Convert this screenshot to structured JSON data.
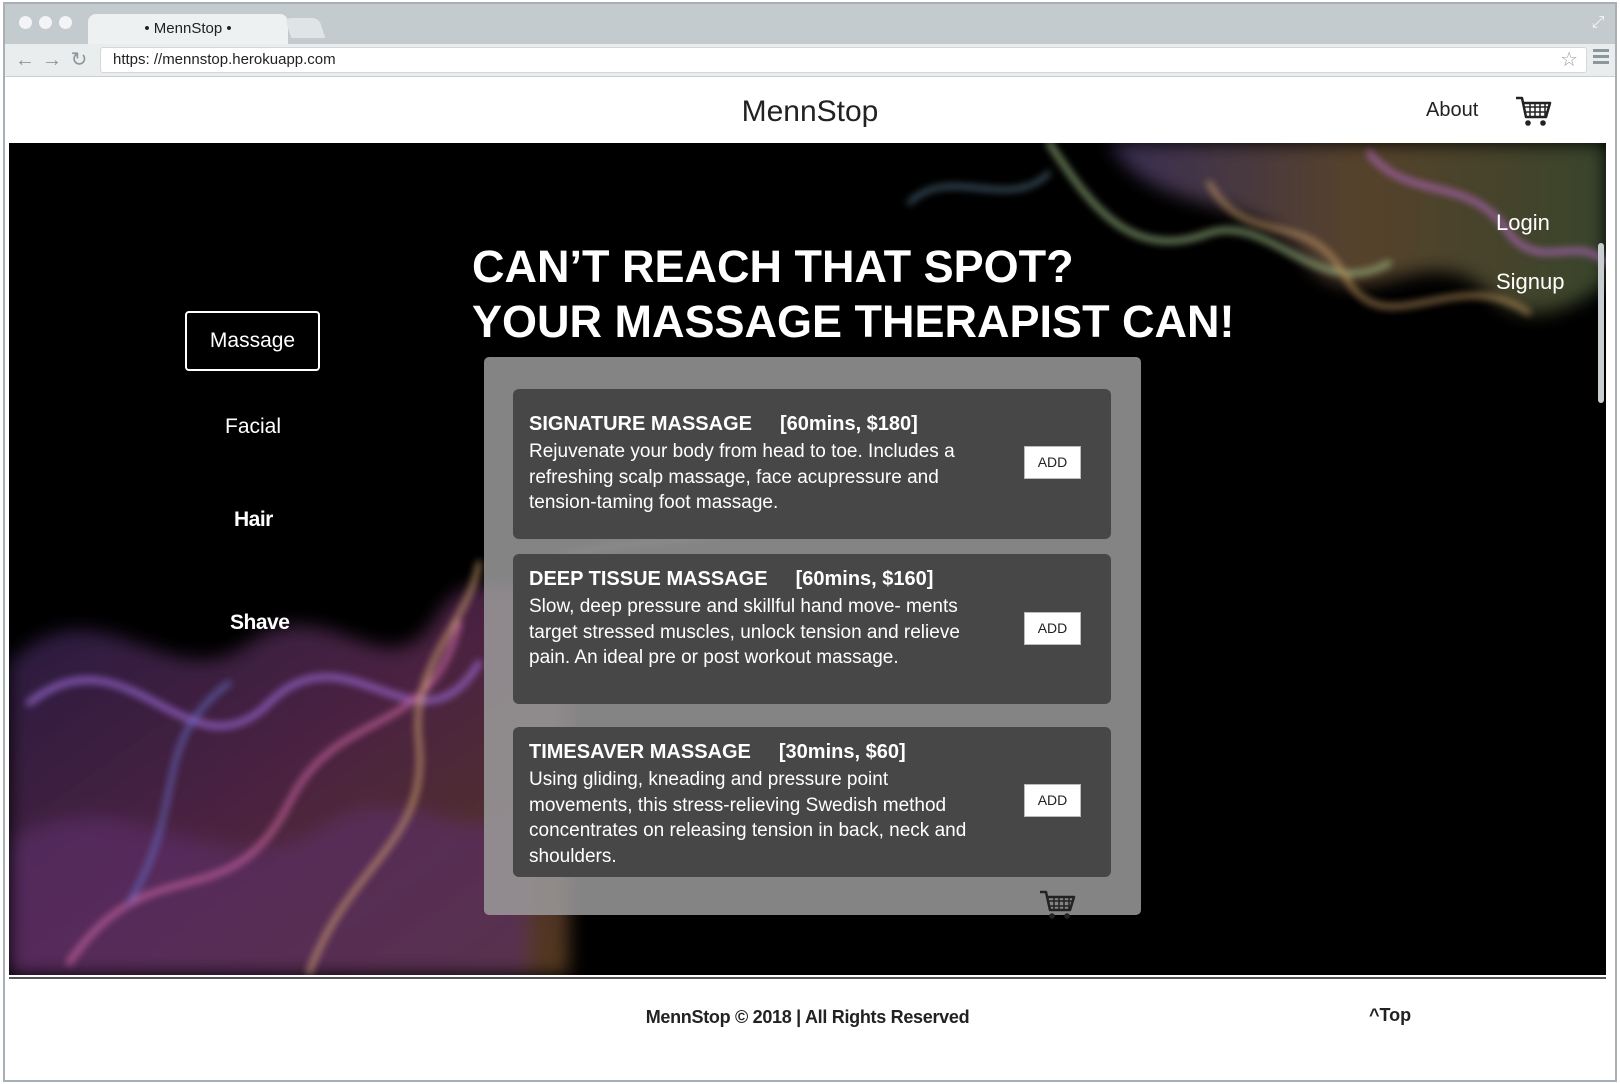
{
  "browser": {
    "tab_title": "• MennStop •",
    "url": "https: //mennstop.herokuapp.com"
  },
  "header": {
    "brand": "MennStop",
    "about": "About"
  },
  "auth": {
    "login": "Login",
    "signup": "Signup"
  },
  "headline": {
    "line1": "CAN’T REACH THAT SPOT?",
    "line2": "YOUR MASSAGE THERAPIST CAN!"
  },
  "sidenav": {
    "items": [
      {
        "label": "Massage",
        "active": true
      },
      {
        "label": "Facial"
      },
      {
        "label": "Hair"
      },
      {
        "label": "Shave"
      }
    ]
  },
  "services": [
    {
      "name": "SIGNATURE MASSAGE",
      "meta": "[60mins, $180]",
      "description": "Rejuvenate your body from head to toe. Includes a refreshing scalp massage, face acupressure and tension-taming foot massage.",
      "add_label": "ADD"
    },
    {
      "name": "DEEP TISSUE MASSAGE",
      "meta": "[60mins, $160]",
      "description": "Slow, deep pressure and skillful hand move- ments target stressed muscles, unlock tension and relieve pain. An ideal pre or post workout massage.",
      "add_label": "ADD"
    },
    {
      "name": "TIMESAVER MASSAGE",
      "meta": "[30mins, $60]",
      "description": "Using gliding, kneading and pressure point movements, this stress-relieving Swedish method concentrates on releasing tension in back, neck and shoulders.",
      "add_label": "ADD"
    }
  ],
  "footer": {
    "copyright": "MennStop © 2018 | All Rights Reserved",
    "top": "^Top"
  },
  "icons": {
    "back": "back-arrow-icon",
    "forward": "forward-arrow-icon",
    "reload": "reload-icon",
    "star": "star-icon",
    "menu": "menu-icon",
    "cart": "cart-icon"
  }
}
